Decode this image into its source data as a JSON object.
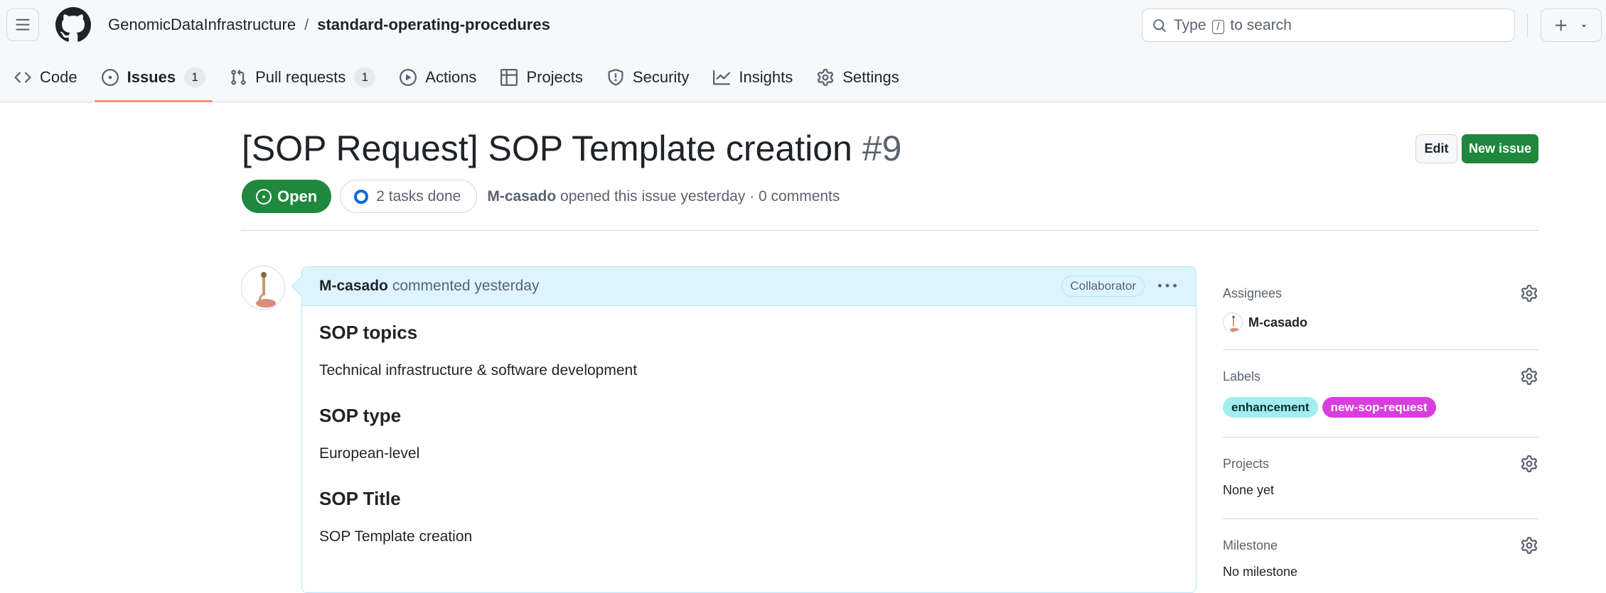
{
  "header": {
    "owner": "GenomicDataInfrastructure",
    "separator": "/",
    "repo": "standard-operating-procedures",
    "search": {
      "prefix": "Type",
      "key": "/",
      "suffix": "to search"
    }
  },
  "tabs": [
    {
      "label": "Code",
      "icon": "code-icon"
    },
    {
      "label": "Issues",
      "icon": "issue-opened-icon",
      "count": "1",
      "selected": true
    },
    {
      "label": "Pull requests",
      "icon": "git-pull-request-icon",
      "count": "1"
    },
    {
      "label": "Actions",
      "icon": "play-icon"
    },
    {
      "label": "Projects",
      "icon": "table-icon"
    },
    {
      "label": "Security",
      "icon": "shield-icon"
    },
    {
      "label": "Insights",
      "icon": "graph-icon"
    },
    {
      "label": "Settings",
      "icon": "gear-icon"
    }
  ],
  "issue": {
    "title": "[SOP Request] SOP Template creation",
    "number": "#9",
    "edit_label": "Edit",
    "new_issue_label": "New issue",
    "state": "Open",
    "tasks": "2 tasks done",
    "author": "M-casado",
    "opened_text": "opened this issue yesterday · 0 comments"
  },
  "comment": {
    "author": "M-casado",
    "action": "commented yesterday",
    "role": "Collaborator",
    "sections": [
      {
        "heading": "SOP topics",
        "text": "Technical infrastructure & software development"
      },
      {
        "heading": "SOP type",
        "text": "European-level"
      },
      {
        "heading": "SOP Title",
        "text": "SOP Template creation"
      }
    ]
  },
  "sidebar": {
    "assignees": {
      "title": "Assignees",
      "name": "M-casado"
    },
    "labels": {
      "title": "Labels",
      "items": [
        "enhancement",
        "new-sop-request"
      ]
    },
    "projects": {
      "title": "Projects",
      "value": "None yet"
    },
    "milestone": {
      "title": "Milestone",
      "value": "No milestone"
    }
  },
  "colors": {
    "open_green": "#1f883d",
    "tab_underline": "#fd8c73",
    "comment_header": "#ddf4ff",
    "label_enhancement": "#a2eeef",
    "label_new_sop_request": "#d93de0"
  }
}
